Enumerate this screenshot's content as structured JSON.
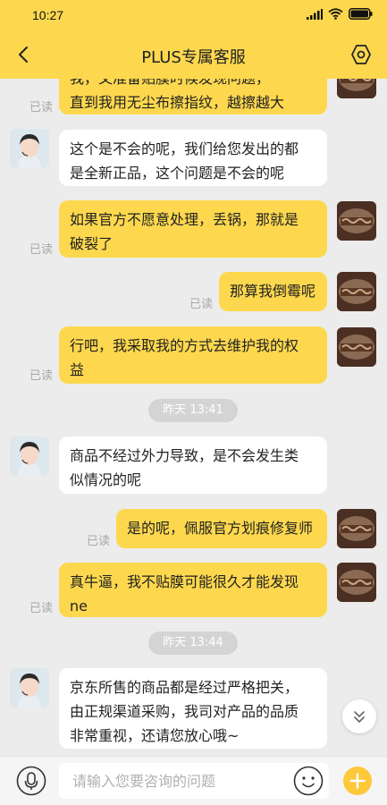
{
  "status": {
    "time": "10:27"
  },
  "nav": {
    "title": "PLUS专属客服"
  },
  "read_label": "已读",
  "messages": [
    {
      "side": "me",
      "lines": [
        "我，又准备贴膜时候发现问题，",
        "直到我用无尘布擦指纹，越擦越大"
      ],
      "read": "已读"
    },
    {
      "side": "them",
      "lines": [
        "这个是不会的呢，我们给您发出的都",
        "是全新正品，这个问题是不会的呢"
      ]
    },
    {
      "side": "me",
      "lines": [
        "如果官方不愿意处理，丢锅，那就是",
        "破裂了"
      ],
      "read": "已读"
    },
    {
      "side": "me",
      "lines": [
        "那算我倒霉呢"
      ],
      "read": "已读"
    },
    {
      "side": "me",
      "lines": [
        "行吧，我采取我的方式去维护我的权",
        "益"
      ],
      "read": "已读"
    },
    {
      "time_divider": "昨天 13:41"
    },
    {
      "side": "them",
      "lines": [
        "商品不经过外力导致，是不会发生类",
        "似情况的呢"
      ]
    },
    {
      "side": "me",
      "lines": [
        "是的呢，佩服官方划痕修复师"
      ],
      "read": "已读"
    },
    {
      "side": "me",
      "lines": [
        "真牛逼，我不贴膜可能很久才能发现",
        "ne"
      ],
      "read": "已读"
    },
    {
      "time_divider": "昨天 13:44"
    },
    {
      "side": "them",
      "lines": [
        "京东所售的商品都是经过严格把关，",
        "由正规渠道采购，我司对产品的品质",
        "非常重视，还请您放心哦~"
      ]
    }
  ],
  "input": {
    "placeholder": "请输入您要咨询的问题",
    "value": ""
  },
  "colors": {
    "accent": "#fdd84e",
    "background": "#ececec"
  },
  "icons": [
    "back-arrow-icon",
    "settings-hex-icon",
    "microphone-icon",
    "emoji-icon",
    "plus-icon",
    "double-chevron-down-icon"
  ]
}
